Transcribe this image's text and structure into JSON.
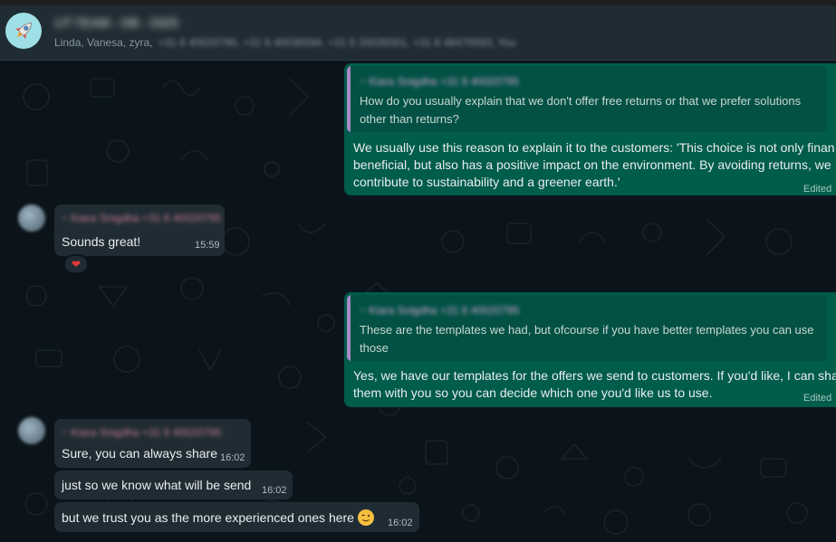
{
  "header": {
    "group_title": "UT-TEAM - DB - 0325",
    "members_visible": "Linda, Vanesa, zyra,",
    "members_hidden": "+31 6 40020795, +31 6 40036594, +31 6 20035001, +31 6 48470593, You"
  },
  "messages": [
    {
      "type": "outgoing",
      "quote": {
        "sender": "~ Kiara Snigdha  +31 6 40020795",
        "text_line1": "How do you usually explain that we don't offer free returns or that we prefer solutions",
        "text_line2": "other than returns?"
      },
      "line1": "We usually use this reason to explain it to the customers: 'This choice is not only finan",
      "line2": "beneficial, but also has a positive impact on the environment. By avoiding returns, we",
      "line3": "contribute to sustainability and a greener earth.'",
      "edited": "Edited"
    },
    {
      "type": "incoming",
      "sender": "~ Kiara Snigdha  +31 6 40020795",
      "text": "Sounds great!",
      "time": "15:59",
      "reaction": "❤"
    },
    {
      "type": "outgoing",
      "quote": {
        "sender": "~ Kiara Snigdha  +31 6 40020795",
        "text_line1": "These are the templates we had, but ofcourse if you have better templates you can use",
        "text_line2": "those"
      },
      "line1": "Yes, we have our templates for the offers we send to customers. If you'd like, I can sha",
      "line2": "them with you so you can decide which one you'd like us to use.",
      "edited": "Edited"
    },
    {
      "type": "incoming",
      "sender": "~ Kiara Snigdha  +31 6 40020795",
      "text": "Sure, you can always share",
      "time": "16:02"
    },
    {
      "type": "incoming",
      "text": "just so we know what will be send",
      "time": "16:02"
    },
    {
      "type": "incoming",
      "text": "but we trust you as the more experienced ones here",
      "time": "16:02",
      "emoji": "winking-face"
    }
  ],
  "colors": {
    "outgoing_bubble": "#005c4b",
    "incoming_bubble": "#202c33",
    "background": "#0b141a",
    "header": "#202c33"
  }
}
